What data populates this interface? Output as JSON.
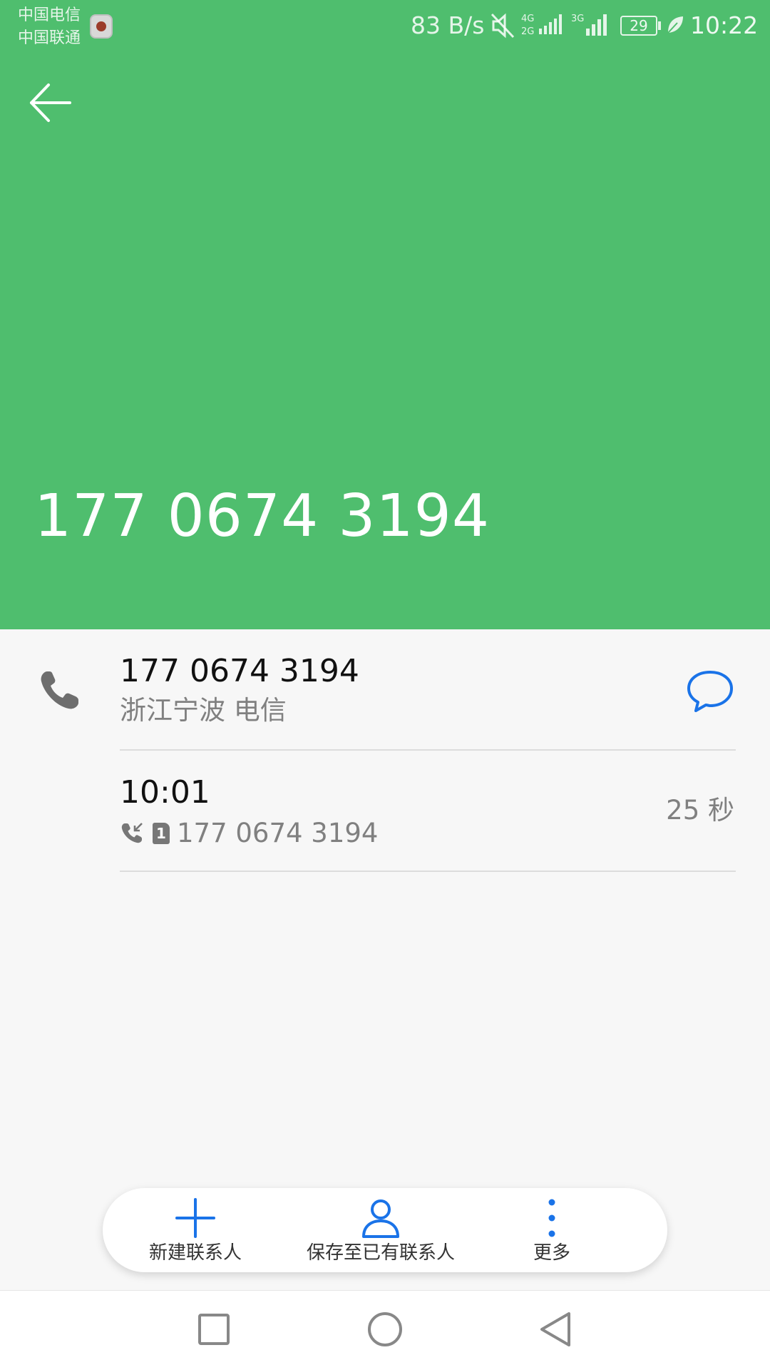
{
  "status_bar": {
    "carrier_1": "中国电信",
    "carrier_2": "中国联通",
    "net_speed": "83 B/s",
    "battery": "29",
    "time": "10:22",
    "icons": [
      "app-notification-icon",
      "mute-icon",
      "signal-4g-icon",
      "signal-3g-icon",
      "battery-icon",
      "leaf-icon"
    ]
  },
  "header": {
    "back_icon": "back-arrow-icon",
    "number": "177 0674 3194",
    "color": "#4fbe6e"
  },
  "detail": {
    "number": "177 0674 3194",
    "location": "浙江宁波 电信",
    "phone_icon": "phone-icon",
    "message_icon": "message-icon",
    "accent": "#1a73e8"
  },
  "call_log": [
    {
      "time": "10:01",
      "number": "177 0674 3194",
      "duration": "25 秒",
      "type_icon": "incoming-call-icon",
      "sim": "1"
    }
  ],
  "actions": {
    "new_contact": "新建联系人",
    "save_to_existing": "保存至已有联系人",
    "more": "更多"
  },
  "nav": {
    "recents_icon": "square-icon",
    "home_icon": "circle-icon",
    "back_icon": "triangle-back-icon"
  }
}
